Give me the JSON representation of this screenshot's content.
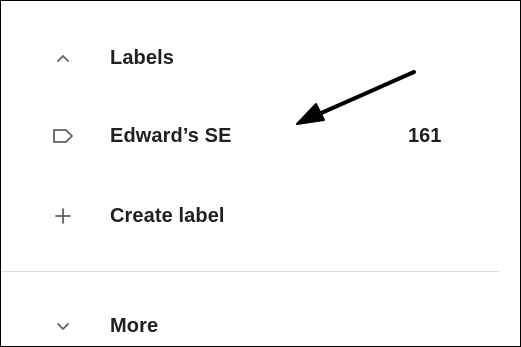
{
  "nav": {
    "labels_header": {
      "label": "Labels",
      "icon": "chevron-up-icon"
    },
    "label_items": [
      {
        "label": "Edward’s SE",
        "count": "161",
        "icon": "label-tag-icon"
      }
    ],
    "create_label": {
      "label": "Create label",
      "icon": "plus-icon"
    },
    "more": {
      "label": "More",
      "icon": "chevron-down-icon"
    }
  },
  "annotation": {
    "type": "arrow",
    "color": "#000000"
  },
  "colors": {
    "text": "#202124",
    "icon": "#5f6368",
    "divider": "#dadce0"
  }
}
